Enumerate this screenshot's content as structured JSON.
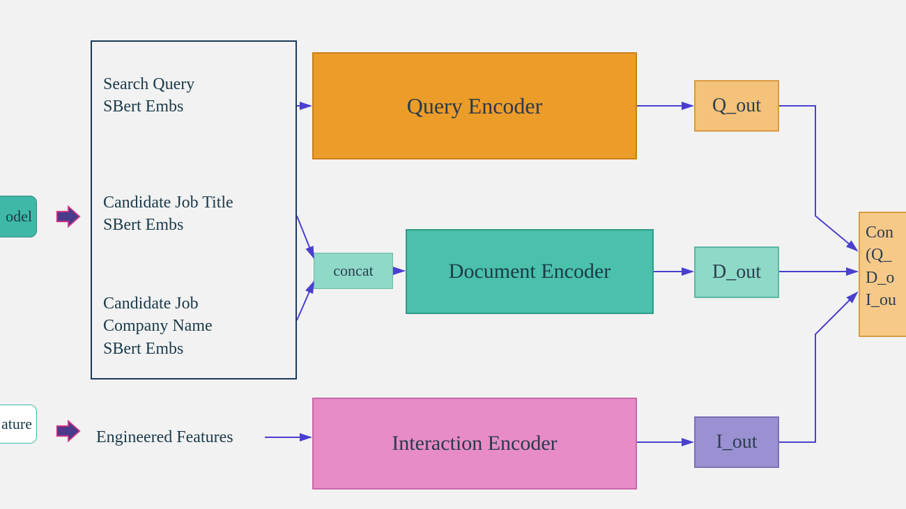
{
  "left": {
    "model_fragment": "odel",
    "feature_fragment": "ature"
  },
  "inputs": {
    "q": "Search Query\nSBert Embs",
    "title": "Candidate Job Title\nSBert Embs",
    "company": "Candidate Job\nCompany Name\nSBert Embs"
  },
  "engineered": "Engineered Features",
  "concat": "concat",
  "encoders": {
    "query": "Query Encoder",
    "document": "Document Encoder",
    "interaction": "Interaction Encoder"
  },
  "outputs": {
    "q": "Q_out",
    "d": "D_out",
    "i": "I_out"
  },
  "concat_out": "Con\n(Q_\nD_o\nI_ou",
  "colors": {
    "arrow": "#4a3fcf",
    "thick_arrow_fill": "#4a3a8a",
    "thick_arrow_stroke": "#d63384"
  }
}
